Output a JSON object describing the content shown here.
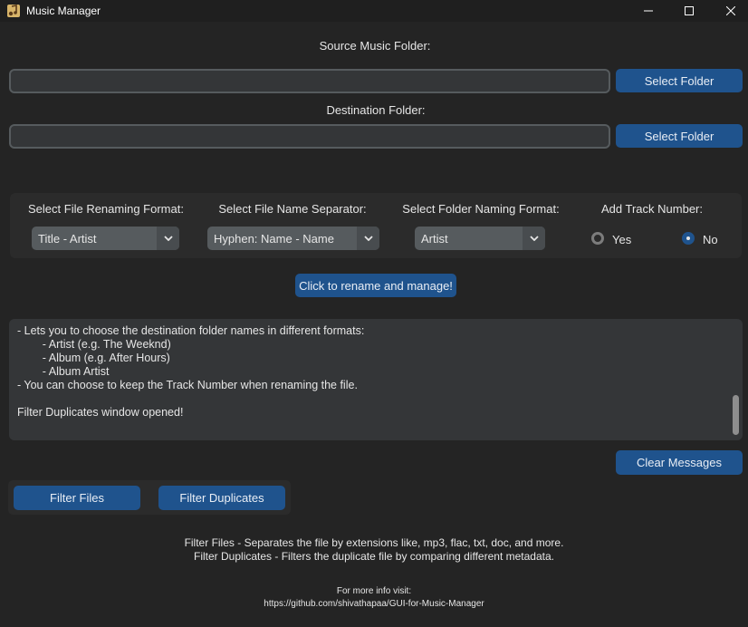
{
  "window": {
    "title": "Music Manager",
    "controls": {
      "minimize_icon": "minimize-icon",
      "maximize_icon": "maximize-icon",
      "close_icon": "close-icon"
    }
  },
  "source": {
    "label": "Source Music Folder:",
    "value": "",
    "button": "Select Folder"
  },
  "destination": {
    "label": "Destination Folder:",
    "value": "",
    "button": "Select Folder"
  },
  "options": {
    "rename_format": {
      "label": "Select File Renaming Format:",
      "selected": "Title - Artist"
    },
    "separator": {
      "label": "Select File Name Separator:",
      "selected": "Hyphen: Name - Name"
    },
    "folder_format": {
      "label": "Select Folder Naming Format:",
      "selected": "Artist"
    },
    "track_number": {
      "label": "Add Track Number:",
      "yes": "Yes",
      "no": "No",
      "selected": "No"
    }
  },
  "run_button": "Click to rename and manage!",
  "log": {
    "lines": [
      "- Lets you to choose the destination folder names in different formats:",
      "        - Artist (e.g. The Weeknd)",
      "        - Album (e.g. After Hours)",
      "        - Album Artist",
      "- You can choose to keep the Track Number when renaming the file.",
      "",
      "Filter Duplicates window opened!"
    ]
  },
  "clear_button": "Clear Messages",
  "filters": {
    "files_button": "Filter Files",
    "duplicates_button": "Filter Duplicates"
  },
  "info": {
    "files": "Filter Files - Separates the file by extensions like, mp3, flac, txt, doc, and more.",
    "duplicates": "Filter Duplicates - Filters the duplicate file by comparing different metadata.",
    "more_info": "For more info visit:",
    "url": "https://github.com/shivathapaa/GUI-for-Music-Manager"
  },
  "colors": {
    "accent": "#1f538d",
    "background": "#242424",
    "entry": "#343638",
    "frame": "#2b2b2b"
  }
}
